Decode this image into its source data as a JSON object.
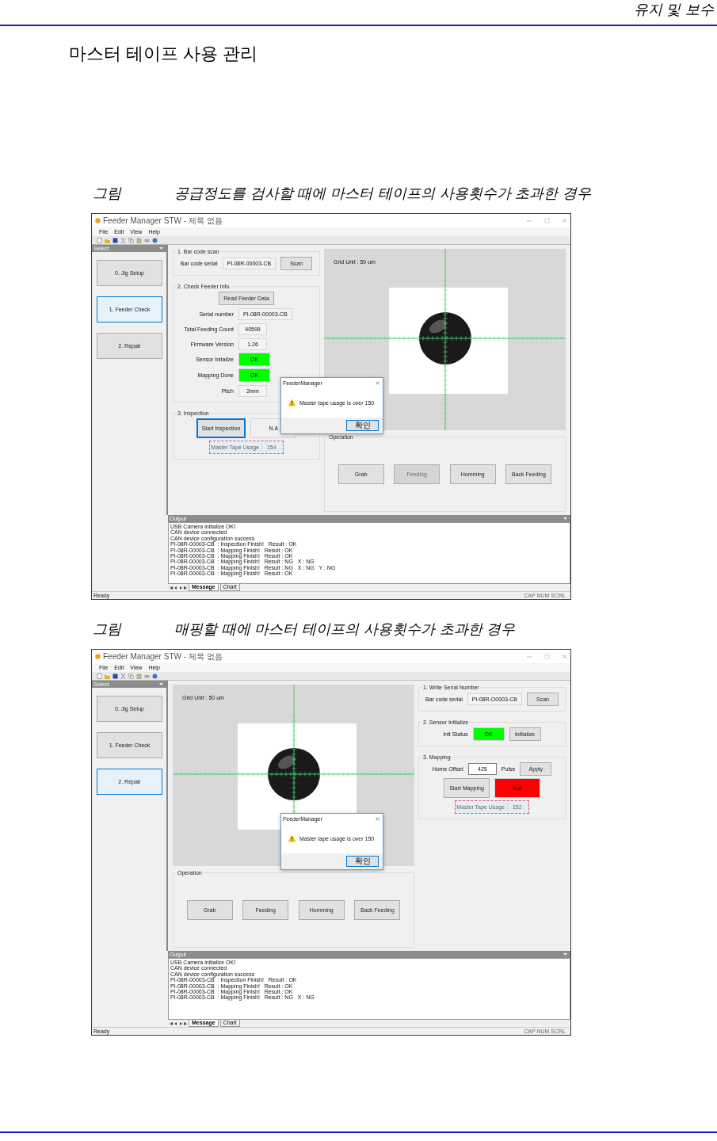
{
  "header": {
    "section": "유지 및 보수"
  },
  "title": "마스터 테이프 사용 관리",
  "figures": [
    {
      "caption_label": "그림",
      "caption": "공급정도를 검사할 때에 마스터 테이프의 사용횟수가 초과한 경우",
      "screen": {
        "window_title": "Feeder Manager STW - 제목 없음",
        "menu": [
          "File",
          "Edit",
          "View",
          "Help"
        ],
        "sidebar": {
          "title": "Select",
          "items": [
            {
              "label": "0. Jig Setup",
              "selected": false
            },
            {
              "label": "1. Feeder Check",
              "selected": true
            },
            {
              "label": "2. Repair",
              "selected": false
            }
          ]
        },
        "columns": [
          {
            "kind": "panel",
            "parts": [
              {
                "kind": "group",
                "title": "1. Bar code scan",
                "lines": [
                  {
                    "items": [
                      {
                        "kind": "label",
                        "text": "Bar code serial"
                      },
                      {
                        "kind": "field",
                        "value": "PI-08R-00003-CB",
                        "editable": false
                      },
                      {
                        "kind": "button",
                        "label": "Scan",
                        "disabled": false,
                        "focused": false
                      }
                    ]
                  }
                ]
              },
              {
                "kind": "group",
                "title": "2. Check Feeder Info",
                "lines": [
                  {
                    "items": [
                      {
                        "kind": "button",
                        "label": "Read Feeder Data",
                        "disabled": false,
                        "focused": false
                      }
                    ]
                  },
                  {
                    "items": [
                      {
                        "kind": "label",
                        "text": "Serial number"
                      },
                      {
                        "kind": "field",
                        "value": "PI-08R-00003-CB",
                        "editable": false
                      }
                    ]
                  },
                  {
                    "items": [
                      {
                        "kind": "label",
                        "text": "Total Feeding Count"
                      },
                      {
                        "kind": "field",
                        "value": "40599",
                        "editable": false
                      }
                    ]
                  },
                  {
                    "items": [
                      {
                        "kind": "label",
                        "text": "Firmware Version"
                      },
                      {
                        "kind": "field",
                        "value": "1.26",
                        "editable": false
                      }
                    ]
                  },
                  {
                    "items": [
                      {
                        "kind": "label",
                        "text": "Sensor Initalize"
                      },
                      {
                        "kind": "status",
                        "value": "OK",
                        "color": "#00ff00"
                      }
                    ]
                  },
                  {
                    "items": [
                      {
                        "kind": "label",
                        "text": "Mapping Done"
                      },
                      {
                        "kind": "status",
                        "value": "OK",
                        "color": "#00ff00"
                      }
                    ]
                  },
                  {
                    "items": [
                      {
                        "kind": "label",
                        "text": "Pitch"
                      },
                      {
                        "kind": "field",
                        "value": "2mm",
                        "editable": false
                      }
                    ]
                  }
                ]
              },
              {
                "kind": "group",
                "title": "3. Inspection",
                "lines": [
                  {
                    "items": [
                      {
                        "kind": "button",
                        "label": "Start Inspection",
                        "disabled": false,
                        "focused": true
                      },
                      {
                        "kind": "status",
                        "value": "N.A",
                        "color": "#f0f0f0"
                      }
                    ]
                  },
                  {
                    "items": [
                      {
                        "kind": "usage",
                        "label": "Master Tape Usage",
                        "value": "154"
                      }
                    ]
                  }
                ]
              }
            ]
          },
          {
            "kind": "view",
            "parts": [
              {
                "kind": "camera",
                "grid_unit": "Grid Unit : 50 um"
              },
              {
                "kind": "group",
                "title": "Operation",
                "lines": [
                  {
                    "items": [
                      {
                        "kind": "button",
                        "label": "Grab",
                        "disabled": false,
                        "focused": false
                      },
                      {
                        "kind": "button",
                        "label": "Feeding",
                        "disabled": true,
                        "focused": false
                      },
                      {
                        "kind": "button",
                        "label": "Homming",
                        "disabled": false,
                        "focused": false
                      },
                      {
                        "kind": "button",
                        "label": "Back Feeding",
                        "disabled": false,
                        "focused": false
                      }
                    ]
                  }
                ]
              }
            ]
          }
        ],
        "dialog": {
          "title": "FeederManager",
          "message": "Master tape usage is over 150",
          "button": "확인"
        },
        "output": {
          "title": "Output",
          "lines": [
            "USB Camera initialize OK!",
            "CAN device connected",
            "CAN device configuration success",
            "PI-08R-00003-CB  : Inspection Finish!   Result : OK",
            "PI-08R-00003-CB  : Mapping Finish!   Result : OK",
            "PI-08R-00003-CB  : Mapping Finish!   Result : OK",
            "PI-08R-00003-CB  : Mapping Finish!   Result : NG   X : NG",
            "PI-08R-00003-CB  : Mapping Finish!   Result : NG   X : NG   Y : NG",
            "PI-08R-00003-CB  : Mapping Finish!   Result : OK"
          ],
          "tabs": [
            {
              "label": "Message",
              "selected": true
            },
            {
              "label": "Chart",
              "selected": false
            }
          ]
        },
        "status": "Ready",
        "indicators": "CAP  NUM  SCRL"
      }
    },
    {
      "caption_label": "그림",
      "caption": "매핑할 때에 마스터 테이프의 사용횟수가 초과한 경우",
      "screen": {
        "window_title": "Feeder Manager STW - 제목 없음",
        "menu": [
          "File",
          "Edit",
          "View",
          "Help"
        ],
        "sidebar": {
          "title": "Select",
          "items": [
            {
              "label": "0. Jig Setup",
              "selected": false
            },
            {
              "label": "1. Feeder Check",
              "selected": false
            },
            {
              "label": "2. Repair",
              "selected": true
            }
          ]
        },
        "columns": [
          {
            "kind": "view",
            "parts": [
              {
                "kind": "camera",
                "grid_unit": "Grid Unit : 50 um"
              },
              {
                "kind": "group",
                "title": "Operation",
                "lines": [
                  {
                    "items": [
                      {
                        "kind": "button",
                        "label": "Grab",
                        "disabled": false,
                        "focused": false
                      },
                      {
                        "kind": "button",
                        "label": "Feeding",
                        "disabled": false,
                        "focused": false
                      },
                      {
                        "kind": "button",
                        "label": "Homming",
                        "disabled": false,
                        "focused": false
                      },
                      {
                        "kind": "button",
                        "label": "Back Feeding",
                        "disabled": false,
                        "focused": false
                      }
                    ]
                  }
                ]
              }
            ]
          },
          {
            "kind": "panel",
            "parts": [
              {
                "kind": "group",
                "title": "1. Write Serial Number",
                "lines": [
                  {
                    "items": [
                      {
                        "kind": "label",
                        "text": "Bar code serial"
                      },
                      {
                        "kind": "field",
                        "value": "PI-08R-O0003-CB",
                        "editable": false
                      },
                      {
                        "kind": "button",
                        "label": "Scan",
                        "disabled": false,
                        "focused": false
                      }
                    ]
                  }
                ]
              },
              {
                "kind": "group",
                "title": "2. Sensor Initialize",
                "lines": [
                  {
                    "items": [
                      {
                        "kind": "label",
                        "text": "Init Status"
                      },
                      {
                        "kind": "status",
                        "value": "OK",
                        "color": "#00ff00"
                      },
                      {
                        "kind": "button",
                        "label": "Initialize",
                        "disabled": false,
                        "focused": false
                      }
                    ]
                  }
                ]
              },
              {
                "kind": "group",
                "title": "3. Mapping",
                "lines": [
                  {
                    "items": [
                      {
                        "kind": "label",
                        "text": "Home Offset"
                      },
                      {
                        "kind": "field",
                        "value": "425",
                        "editable": true
                      },
                      {
                        "kind": "label",
                        "text": "Pulse"
                      },
                      {
                        "kind": "button",
                        "label": "Apply",
                        "disabled": false,
                        "focused": false
                      }
                    ]
                  },
                  {
                    "items": [
                      {
                        "kind": "button",
                        "label": "Start Mapping",
                        "disabled": false,
                        "focused": false
                      },
                      {
                        "kind": "status",
                        "value": "N.A",
                        "color": "#ff0000"
                      }
                    ]
                  },
                  {
                    "items": [
                      {
                        "kind": "usage",
                        "label": "Master Tape Usage",
                        "value": "152"
                      }
                    ]
                  }
                ]
              }
            ]
          }
        ],
        "dialog": {
          "title": "FeederManager",
          "message": "Master tape usage is over 150",
          "button": "확인"
        },
        "output": {
          "title": "Output",
          "lines": [
            "USB Camera initialize OK!",
            "CAN device connected",
            "CAN device configuration success",
            "PI-08R-00003-CB  : Inspection Finish!   Result : OK",
            "PI-08R-00003-CB  : Mapping Finish!   Result : OK",
            "PI-08R-00003-CB  : Mapping Finish!   Result : OK",
            "PI-08R-00003-CB  : Mapping Finish!   Result : NG   X : NG"
          ],
          "tabs": [
            {
              "label": "Message",
              "selected": true
            },
            {
              "label": "Chart",
              "selected": false
            }
          ]
        },
        "status": "Ready",
        "indicators": "CAP  NUM  SCRL"
      }
    }
  ]
}
